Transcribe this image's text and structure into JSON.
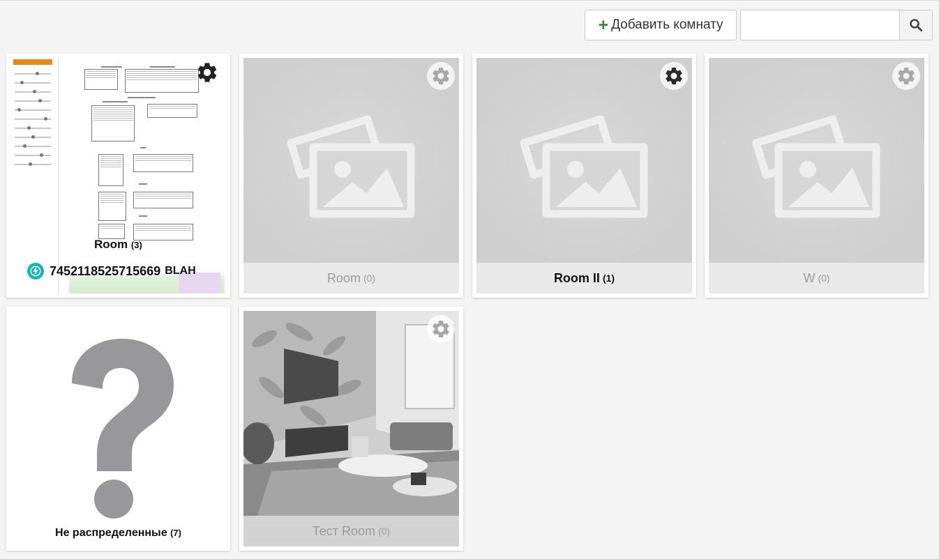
{
  "toolbar": {
    "add_room_label": "Добавить комнату",
    "search_placeholder": "",
    "search_value": ""
  },
  "rooms": [
    {
      "name": "Room",
      "count": "(3)",
      "active": true,
      "device_value": "745211852571566​9",
      "device_unit": "BLAH"
    },
    {
      "name": "Room",
      "count": "(0)",
      "active": false
    },
    {
      "name": "Room II",
      "count": "(1)",
      "active": true
    },
    {
      "name": "W",
      "count": "(0)",
      "active": false
    },
    {
      "name": "Тест Room",
      "count": "(0)",
      "active": false
    }
  ],
  "unassigned": {
    "label": "Не распределенные",
    "count": "(7)"
  },
  "colors": {
    "accent_plus": "#3a8a3a",
    "device_icon": "#19b5b0",
    "question_mark": "#98989c"
  },
  "icons": {
    "add": "plus-icon",
    "search": "search-icon",
    "settings": "gear-icon",
    "placeholder": "image-placeholder-icon",
    "device": "lightning-icon",
    "unassigned": "question-mark-icon"
  }
}
